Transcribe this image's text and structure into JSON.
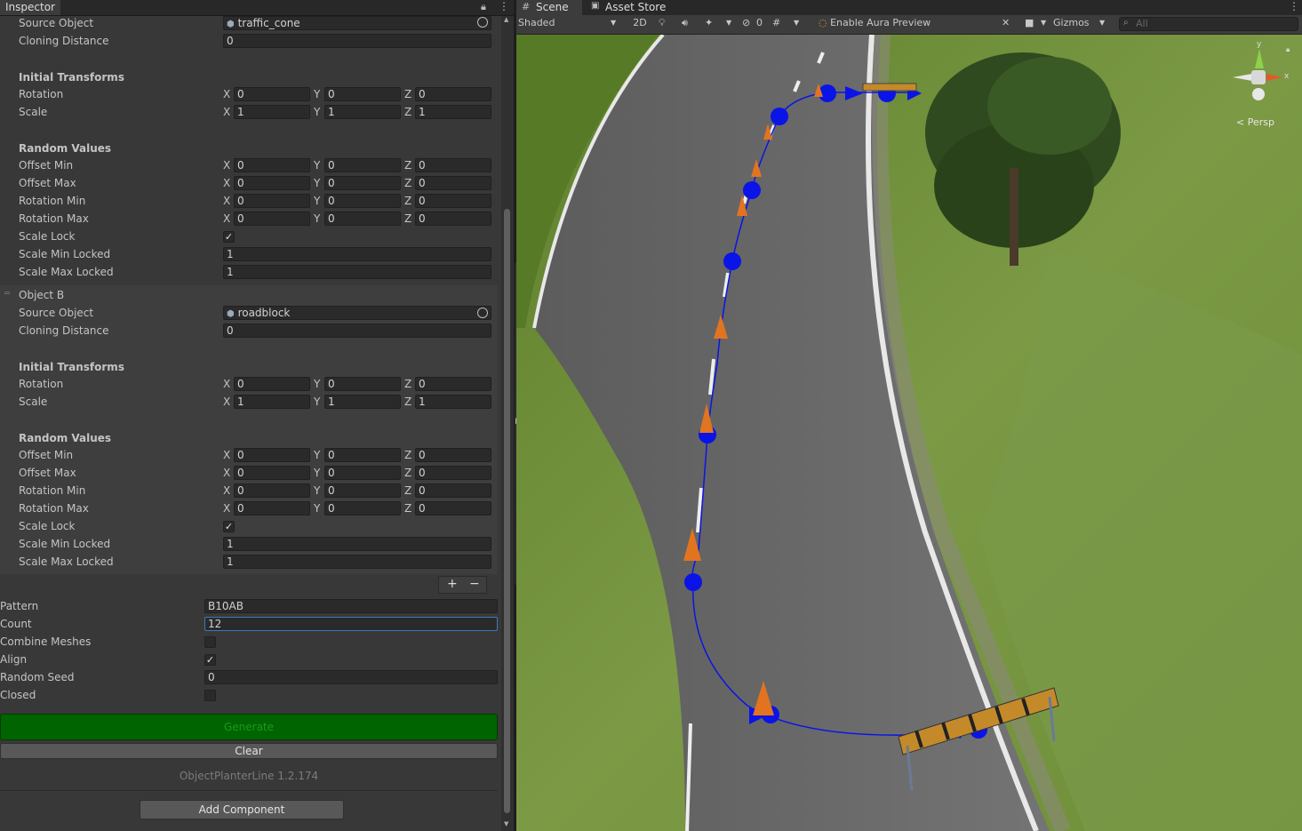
{
  "inspector": {
    "tab_title": "Inspector",
    "object_a": {
      "source_object_label": "Source Object",
      "source_object_value": "traffic_cone",
      "cloning_distance_label": "Cloning Distance",
      "cloning_distance_value": "0",
      "initial_transforms_header": "Initial Transforms",
      "rotation_label": "Rotation",
      "rotation": [
        "0",
        "0",
        "0"
      ],
      "scale_label": "Scale",
      "scale": [
        "1",
        "1",
        "1"
      ],
      "random_values_header": "Random Values",
      "offset_min_label": "Offset Min",
      "offset_min": [
        "0",
        "0",
        "0"
      ],
      "offset_max_label": "Offset Max",
      "offset_max": [
        "0",
        "0",
        "0"
      ],
      "rotation_min_label": "Rotation Min",
      "rotation_min": [
        "0",
        "0",
        "0"
      ],
      "rotation_max_label": "Rotation Max",
      "rotation_max": [
        "0",
        "0",
        "0"
      ],
      "scale_lock_label": "Scale Lock",
      "scale_lock": true,
      "scale_min_locked_label": "Scale Min Locked",
      "scale_min_locked_value": "1",
      "scale_max_locked_label": "Scale Max Locked",
      "scale_max_locked_value": "1"
    },
    "object_b": {
      "title": "Object B",
      "source_object_label": "Source Object",
      "source_object_value": "roadblock",
      "cloning_distance_label": "Cloning Distance",
      "cloning_distance_value": "0",
      "initial_transforms_header": "Initial Transforms",
      "rotation_label": "Rotation",
      "rotation": [
        "0",
        "0",
        "0"
      ],
      "scale_label": "Scale",
      "scale": [
        "1",
        "1",
        "1"
      ],
      "random_values_header": "Random Values",
      "offset_min_label": "Offset Min",
      "offset_min": [
        "0",
        "0",
        "0"
      ],
      "offset_max_label": "Offset Max",
      "offset_max": [
        "0",
        "0",
        "0"
      ],
      "rotation_min_label": "Rotation Min",
      "rotation_min": [
        "0",
        "0",
        "0"
      ],
      "rotation_max_label": "Rotation Max",
      "rotation_max": [
        "0",
        "0",
        "0"
      ],
      "scale_lock_label": "Scale Lock",
      "scale_lock": true,
      "scale_min_locked_label": "Scale Min Locked",
      "scale_min_locked_value": "1",
      "scale_max_locked_label": "Scale Max Locked",
      "scale_max_locked_value": "1"
    },
    "axis_labels": [
      "X",
      "Y",
      "Z"
    ],
    "list_add": "+",
    "list_remove": "−",
    "pattern_label": "Pattern",
    "pattern_value": "B10AB",
    "count_label": "Count",
    "count_value": "12",
    "combine_meshes_label": "Combine Meshes",
    "combine_meshes": false,
    "align_label": "Align",
    "align": true,
    "random_seed_label": "Random Seed",
    "random_seed_value": "0",
    "closed_label": "Closed",
    "closed": false,
    "generate_button": "Generate",
    "clear_button": "Clear",
    "version": "ObjectPlanterLine 1.2.174",
    "add_component_button": "Add Component",
    "colors": {
      "generate_bg": "#006400",
      "generate_text": "#1a9a1a",
      "focus_border": "#3a79bb"
    }
  },
  "scene": {
    "tab_scene": "Scene",
    "tab_asset_store": "Asset Store",
    "shading_mode": "Shaded",
    "mode_2d": "2D",
    "hidden_count": "0",
    "aura_preview": "Enable Aura Preview",
    "gizmos": "Gizmos",
    "search_placeholder": "All",
    "gizmo_axis_x": "x",
    "gizmo_axis_y": "y",
    "persp_label": "< Persp",
    "colors": {
      "grass": "#6f8f3a",
      "road": "#6b6b6b",
      "spline": "#0a14e6"
    }
  }
}
